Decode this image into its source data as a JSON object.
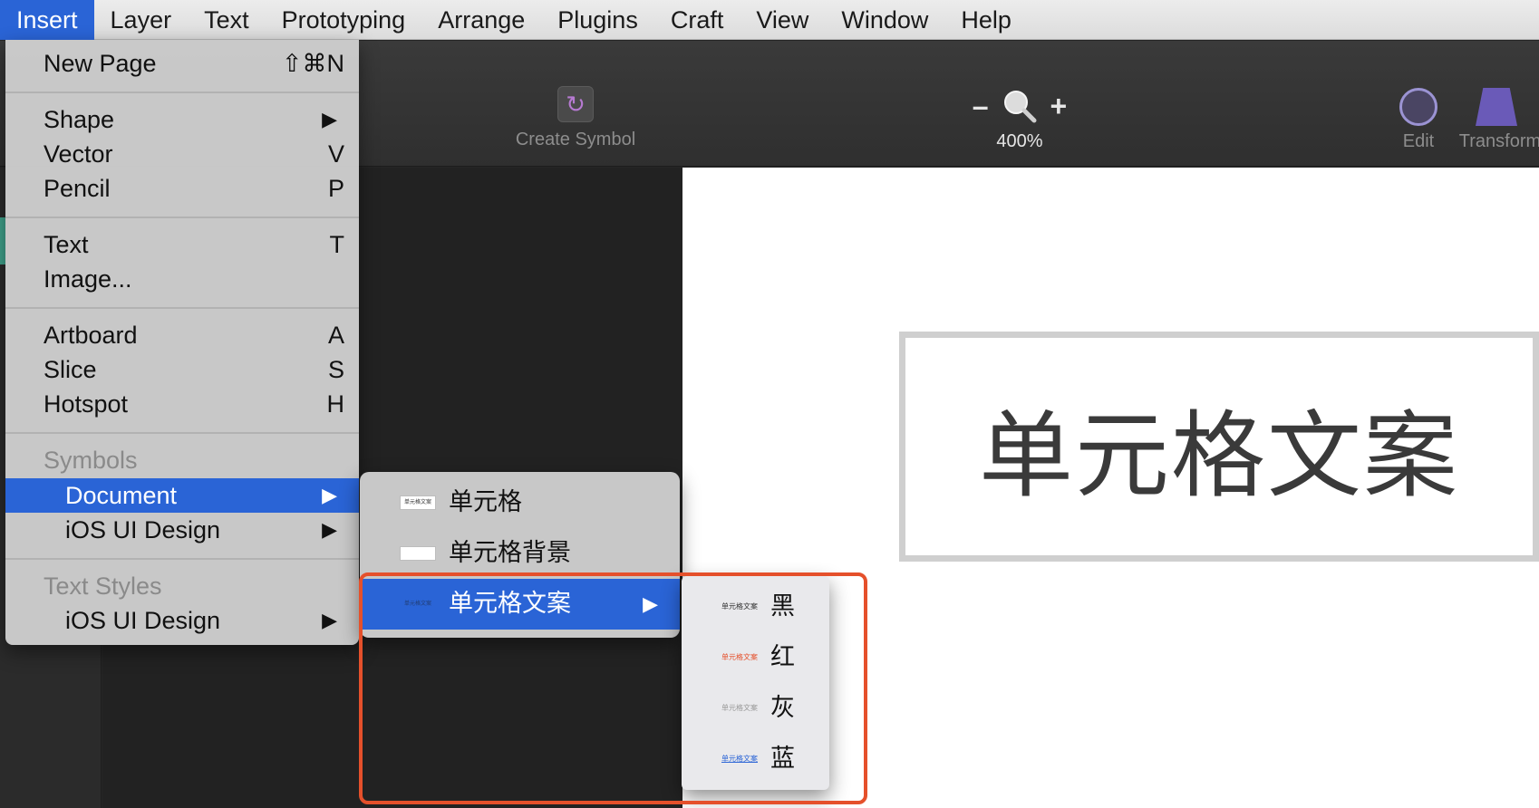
{
  "menubar": {
    "items": [
      "Insert",
      "Layer",
      "Text",
      "Prototyping",
      "Arrange",
      "Plugins",
      "Craft",
      "View",
      "Window",
      "Help"
    ],
    "active": "Insert"
  },
  "toolbar": {
    "create_symbol_label": "Create Symbol",
    "zoom_minus": "–",
    "zoom_plus": "+",
    "zoom_value": "400%",
    "edit_label": "Edit",
    "transform_label": "Transform"
  },
  "insert_menu": {
    "new_page": {
      "label": "New Page",
      "shortcut": "⇧⌘N"
    },
    "shape": {
      "label": "Shape",
      "arrow": "▶"
    },
    "vector": {
      "label": "Vector",
      "shortcut": "V"
    },
    "pencil": {
      "label": "Pencil",
      "shortcut": "P"
    },
    "text": {
      "label": "Text",
      "shortcut": "T"
    },
    "image": {
      "label": "Image..."
    },
    "artboard": {
      "label": "Artboard",
      "shortcut": "A"
    },
    "slice": {
      "label": "Slice",
      "shortcut": "S"
    },
    "hotspot": {
      "label": "Hotspot",
      "shortcut": "H"
    },
    "symbols_header": "Symbols",
    "document": {
      "label": "Document",
      "arrow": "▶"
    },
    "ios_ui_design_symbols": {
      "label": "iOS UI Design",
      "arrow": "▶"
    },
    "text_styles_header": "Text Styles",
    "ios_ui_design_text": {
      "label": "iOS UI Design",
      "arrow": "▶"
    }
  },
  "document_submenu": {
    "items": [
      {
        "label": "单元格",
        "thumb": "单元格文案"
      },
      {
        "label": "单元格背景"
      },
      {
        "label": "单元格文案",
        "thumb": "单元格文案",
        "arrow": "▶"
      }
    ]
  },
  "color_submenu": {
    "items": [
      {
        "label": "黑",
        "mini": "单元格文案",
        "color": "#333333"
      },
      {
        "label": "红",
        "mini": "单元格文案",
        "color": "#e5502b"
      },
      {
        "label": "灰",
        "mini": "单元格文案",
        "color": "#999999"
      },
      {
        "label": "蓝",
        "mini": "单元格文案",
        "color": "#2a64d6"
      }
    ]
  },
  "canvas": {
    "cell_text": "单元格文案"
  },
  "colors": {
    "menu_highlight": "#2a64d6",
    "annotation": "#e5502b"
  }
}
